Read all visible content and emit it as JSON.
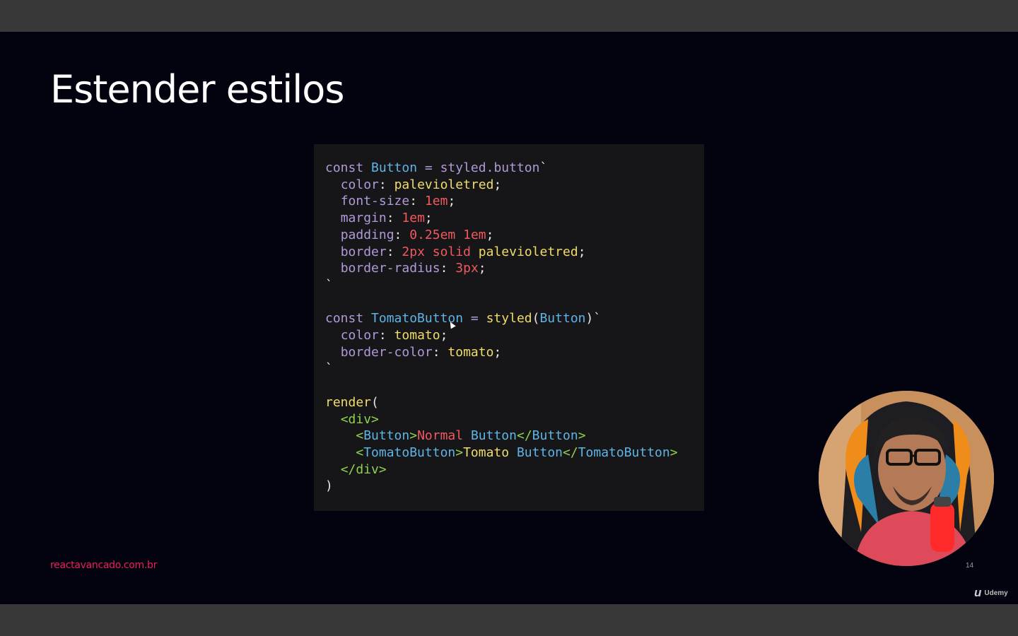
{
  "slide": {
    "title": "Estender estilos",
    "footer_url": "reactavancado.com.br",
    "page_number": "14"
  },
  "brand": {
    "name": "Udemy",
    "icon": "udemy-logo-icon"
  },
  "code": {
    "language": "javascript",
    "lines": [
      "const Button = styled.button`",
      "  color: palevioletred;",
      "  font-size: 1em;",
      "  margin: 1em;",
      "  padding: 0.25em 1em;",
      "  border: 2px solid palevioletred;",
      "  border-radius: 3px;",
      "`",
      "",
      "const TomatoButton = styled(Button)`",
      "  color: tomato;",
      "  border-color: tomato;",
      "`",
      "",
      "render(",
      "  <div>",
      "    <Button>Normal Button</Button>",
      "    <TomatoButton>Tomato Button</TomatoButton>",
      "  </div>",
      ")"
    ]
  },
  "colors": {
    "slide_background": "#03030f",
    "code_background": "#161618",
    "accent": "#e8205a"
  }
}
